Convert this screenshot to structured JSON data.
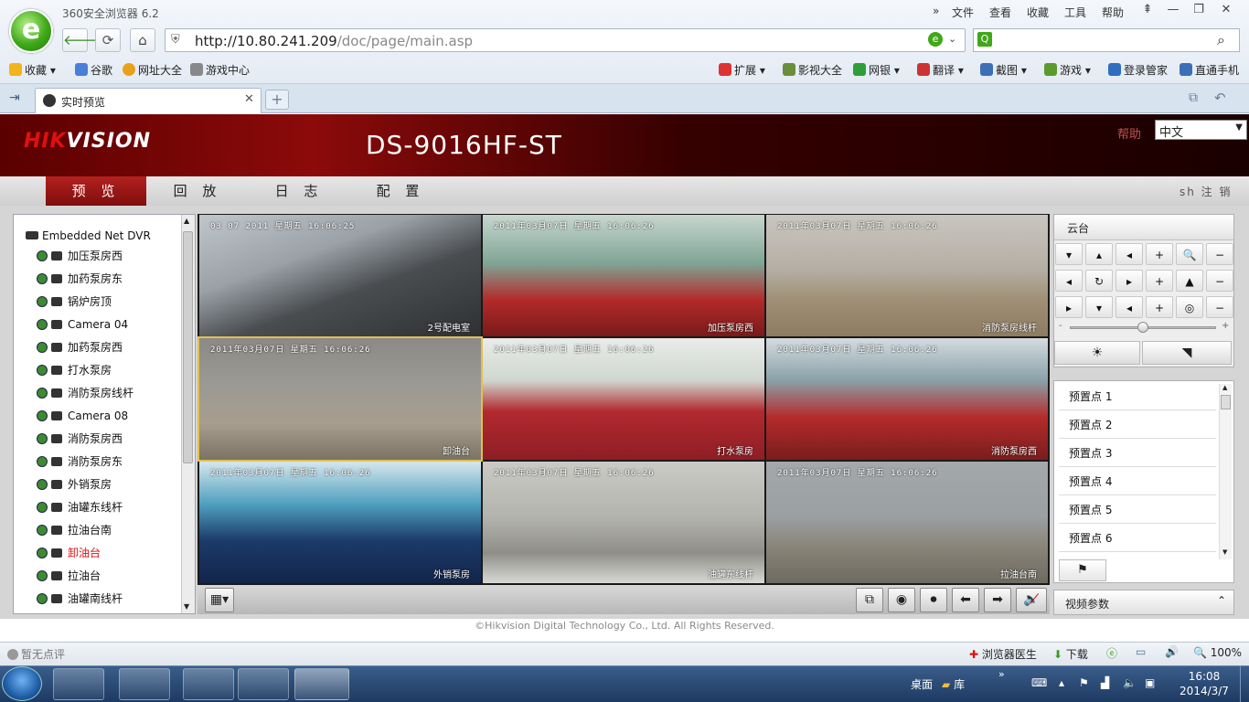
{
  "browser": {
    "app_name": "360安全浏览器 6.2",
    "menu": [
      "文件",
      "查看",
      "收藏",
      "工具",
      "帮助"
    ],
    "url_host": "http://10.80.241.209",
    "url_path": "/doc/page/main.asp",
    "bookmarks": [
      "收藏",
      "谷歌",
      "网址大全",
      "游戏中心"
    ],
    "toolbar_right": [
      "扩展",
      "影视大全",
      "网银",
      "翻译",
      "截图",
      "游戏",
      "登录管家",
      "直通手机"
    ],
    "tab_title": "实时预览",
    "status_left": "暂无点评",
    "status_right": [
      "浏览器医生",
      "下载",
      "100%"
    ]
  },
  "app": {
    "brand": "HIKVISION",
    "model": "DS-9016HF-ST",
    "help": "帮助",
    "language": "中文",
    "nav": [
      "预 览",
      "回 放",
      "日 志",
      "配 置"
    ],
    "active_nav": 0,
    "logout": "sh 注 销",
    "tree_root": "Embedded Net DVR",
    "cameras": [
      "加压泵房西",
      "加药泵房东",
      "锅炉房顶",
      "Camera 04",
      "加药泵房西",
      "打水泵房",
      "消防泵房线杆",
      "Camera 08",
      "消防泵房西",
      "消防泵房东",
      "外销泵房",
      "油罐东线杆",
      "拉油台南",
      "卸油台",
      "拉油台",
      "油罐南线杆"
    ],
    "selected_camera": 13,
    "ptz_title": "云台",
    "presets": [
      "预置点 1",
      "预置点 2",
      "预置点 3",
      "预置点 4",
      "预置点 5",
      "预置点 6"
    ],
    "video_params": "视频参数",
    "copyright": "©Hikvision Digital Technology Co., Ltd. All Rights Reserved."
  },
  "tiles": [
    {
      "ts": "03 07 2011 星期五 16:06:25",
      "name": "2号配电室"
    },
    {
      "ts": "2011年03月07日 星期五 16:06:26",
      "name": "加压泵房西"
    },
    {
      "ts": "2011年03月07日 星期五 16:06:26",
      "name": "消防泵房线杆"
    },
    {
      "ts": "2011年03月07日 星期五 16:06:26",
      "name": "卸油台"
    },
    {
      "ts": "2011年03月07日 星期五 16:06:26",
      "name": "打水泵房"
    },
    {
      "ts": "2011年03月07日 星期五 16:06:26",
      "name": "消防泵房西"
    },
    {
      "ts": "2011年03月07日 星期五 16:06:26",
      "name": "外销泵房"
    },
    {
      "ts": "2011年03月07日 星期五 16:06:26",
      "name": "油罐东线杆"
    },
    {
      "ts": "2011年03月07日 星期五 16:06:26",
      "name": "拉油台南"
    }
  ],
  "taskbar": {
    "desktop": "桌面",
    "library": "库",
    "time": "16:08",
    "date": "2014/3/7"
  }
}
